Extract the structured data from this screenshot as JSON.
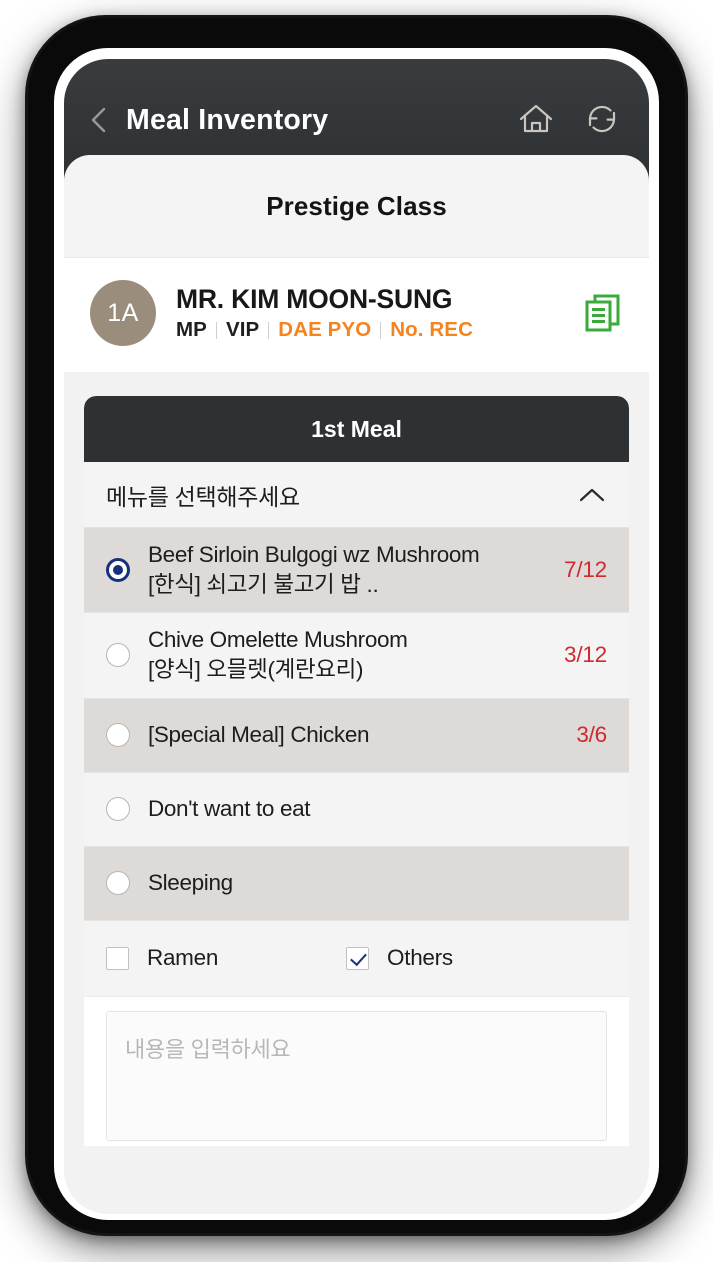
{
  "appbar": {
    "back_icon": "chevron-left-icon",
    "title": "Meal Inventory",
    "home_icon": "home-icon",
    "refresh_icon": "refresh-icon"
  },
  "class_tab": {
    "label": "Prestige Class"
  },
  "passenger": {
    "seat": "1A",
    "name": "MR. KIM MOON-SUNG",
    "tags": [
      {
        "text": "MP",
        "accent": false
      },
      {
        "text": "VIP",
        "accent": false
      },
      {
        "text": "DAE PYO",
        "accent": true
      },
      {
        "text": "No. REC",
        "accent": true
      }
    ],
    "doc_icon": "documents-copy-icon",
    "accent_color": "#f5841f",
    "seat_badge_color": "#9b8d7c",
    "doc_icon_color": "#3aab3a"
  },
  "meal": {
    "header_title": "1st Meal",
    "dropdown": {
      "label": "메뉴를 선택해주세요",
      "chevron_icon": "chevron-up-icon",
      "expanded": true
    },
    "options": [
      {
        "line1": "Beef Sirloin Bulgogi wz Mushroom",
        "line2": "[한식] 쇠고기 불고기 밥 ..",
        "count": "7/12",
        "selected": true
      },
      {
        "line1": "Chive Omelette Mushroom",
        "line2": "[양식] 오믈렛(계란요리)",
        "count": "3/12",
        "selected": false
      },
      {
        "line1": "[Special Meal] Chicken",
        "line2": "",
        "count": "3/6",
        "selected": false
      },
      {
        "line1": "Don't want to eat",
        "line2": "",
        "count": "",
        "selected": false
      },
      {
        "line1": "Sleeping",
        "line2": "",
        "count": "",
        "selected": false
      }
    ],
    "checkboxes": [
      {
        "label": "Ramen",
        "checked": false
      },
      {
        "label": "Others",
        "checked": true
      }
    ],
    "note": {
      "value": "",
      "placeholder": "내용을 입력하세요"
    },
    "count_color": "#d0292f",
    "selected_color": "#17307c"
  }
}
